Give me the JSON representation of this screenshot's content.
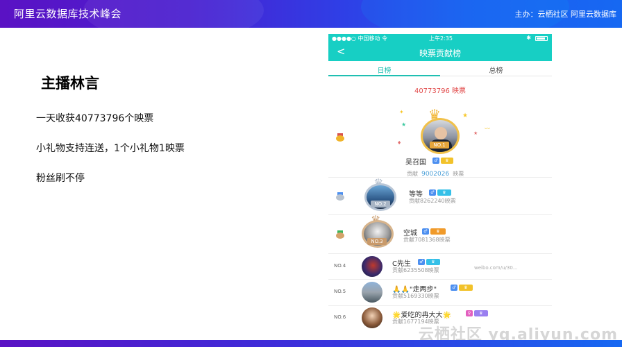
{
  "slide": {
    "title": "阿里云数据库技术峰会",
    "host": "主办：云栖社区 阿里云数据库",
    "anchor_title": "主播林言",
    "bullets": [
      "一天收获40773796个映票",
      "小礼物支持连送，1个小礼物1映票",
      "粉丝刷不停"
    ]
  },
  "phone": {
    "status": {
      "carrier": "●●●●○ 中国移动 令",
      "time": "上午2:35",
      "bt": "✱"
    },
    "nav": {
      "back": "<",
      "title": "映票贡献榜"
    },
    "tabs": {
      "daily": "日榜",
      "total": "总榜"
    },
    "total_votes": "40773796 映票",
    "ranking": [
      {
        "rank_label": "NO.1",
        "name": "吴召国",
        "contribution_prefix": "贡献",
        "contribution_value": "9002026",
        "contribution_suffix": "映票"
      },
      {
        "rank_label": "NO.2",
        "name": "等等",
        "contribution": "贡献8262240映票"
      },
      {
        "rank_label": "NO.3",
        "name": "空城",
        "contribution": "贡献7081368映票"
      },
      {
        "rank_label": "NO.4",
        "name": "C先生",
        "contribution": "贡献6235508映票"
      },
      {
        "rank_label": "NO.5",
        "name": "🙏🙏\"走两步\"",
        "contribution": "贡献5169330映票"
      },
      {
        "rank_label": "NO.6",
        "name": "🌟爱吃的冉大大🌟",
        "contribution": "贡献1677194映票"
      }
    ],
    "badges": {
      "r1": [
        "♂",
        "♛"
      ],
      "r2": [
        "♂",
        "♛"
      ],
      "r3": [
        "♂",
        "♛"
      ],
      "r4": [
        "♂",
        "♛"
      ],
      "r5": [
        "♂",
        "♛"
      ],
      "r6": [
        "♀",
        "♛"
      ]
    }
  },
  "watermark": "云栖社区 yq.aliyun.com",
  "weibo": "weibo.com/u/30..."
}
